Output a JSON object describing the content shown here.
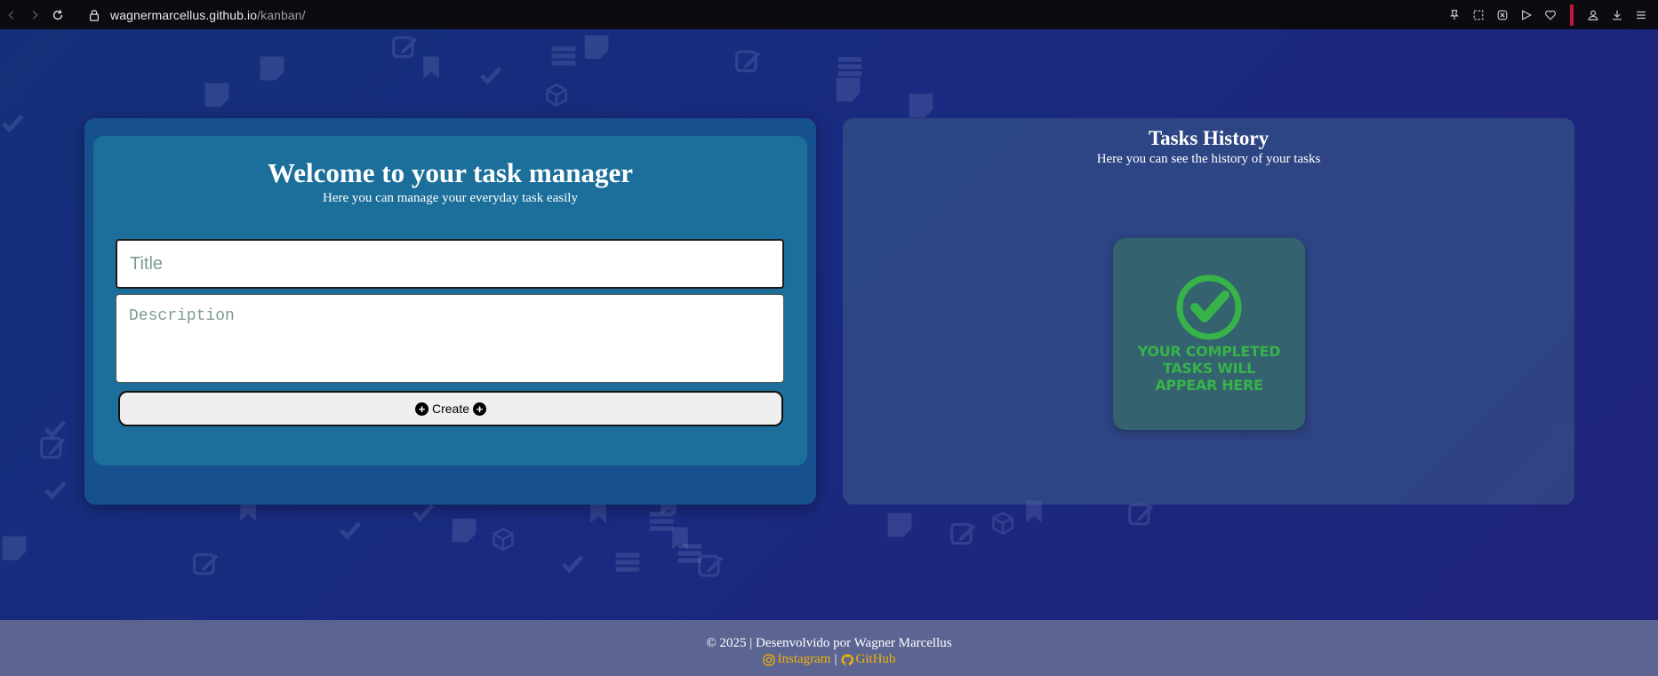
{
  "browser": {
    "url_host": "wagnermarcellus.github.io",
    "url_path": "/kanban/"
  },
  "task_form": {
    "title": "Welcome to your task manager",
    "subtitle": "Here you can manage your everyday task easily",
    "title_placeholder": "Title",
    "title_value": "",
    "description_placeholder": "Description",
    "description_value": "",
    "create_label": "Create"
  },
  "history": {
    "title": "Tasks History",
    "subtitle": "Here you can see the history of your tasks",
    "empty_line1": "YOUR COMPLETED",
    "empty_line2": "TASKS WILL",
    "empty_line3": "APPEAR HERE"
  },
  "footer": {
    "copyright": "© 2025 | Desenvolvido por Wagner Marcellus",
    "instagram_label": "Instagram",
    "separator": "|",
    "github_label": "GitHub"
  },
  "icons": {
    "back": "back-arrow-icon",
    "forward": "forward-arrow-icon",
    "reload": "reload-icon",
    "lock": "lock-icon",
    "plus": "plus-circle-icon",
    "check": "check-circle-icon",
    "instagram": "instagram-icon",
    "github": "github-icon"
  },
  "colors": {
    "background": "#1a2a80",
    "left_panel": "#16508e",
    "form_card": "#1b6f9a",
    "history_card": "#35626f",
    "check_green": "#37b34a",
    "footer_bg": "#5c6592",
    "footer_link": "#f2b100"
  }
}
